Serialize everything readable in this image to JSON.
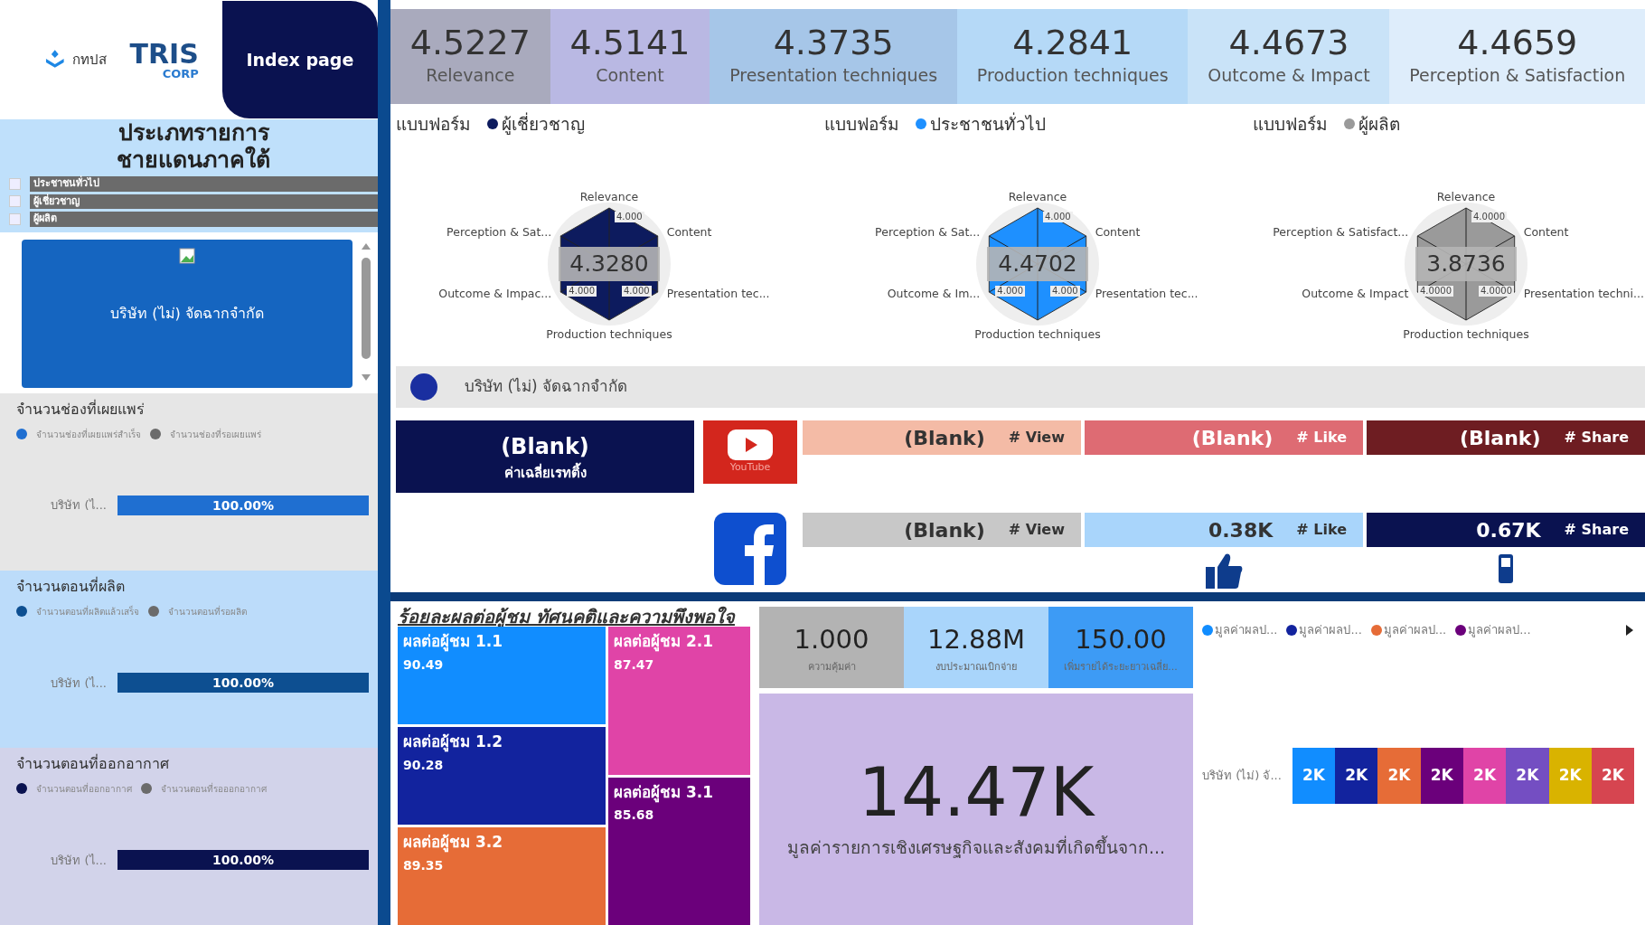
{
  "sidebar": {
    "agency_logo": "กทปส",
    "tris_logo": "TRIS",
    "tris_sub": "CORP",
    "index_button": "Index page",
    "filter": {
      "title": "ประเภทรายการชายแดนภาคใต้",
      "options": [
        {
          "label": "ประชาชนทั่วไป",
          "checked": false
        },
        {
          "label": "ผู้เชี่ยวชาญ",
          "checked": false
        },
        {
          "label": "ผู้ผลิต",
          "checked": false
        }
      ]
    },
    "company_list": {
      "items": [
        {
          "label": "บริษัท (ไม่) จัดฉากจำกัด",
          "selected": true
        }
      ]
    },
    "sections": [
      {
        "title": "จำนวนช่องที่เผยแพร่",
        "legend": [
          {
            "label": "จำนวนช่องที่เผยแพร่สำเร็จ",
            "color": "#1f6fd1"
          },
          {
            "label": "จำนวนช่องที่รอเผยแพร่",
            "color": "#6b6b6b"
          }
        ],
        "bar": {
          "label": "บริษัท (ไ...",
          "level": 1,
          "reading": "100.00%"
        }
      },
      {
        "title": "จำนวนตอนที่ผลิต",
        "legend": [
          {
            "label": "จำนวนตอนที่ผลิตแล้วเสร็จ",
            "color": "#0d4f91"
          },
          {
            "label": "จำนวนตอนที่รอผลิต",
            "color": "#6b6b6b"
          }
        ],
        "bar": {
          "label": "บริษัท (ไ...",
          "level": 1,
          "reading": "100.00%"
        }
      },
      {
        "title": "จำนวนตอนที่ออกอากาศ",
        "legend": [
          {
            "label": "จำนวนตอนที่ออกอากาศ",
            "color": "#0a1250"
          },
          {
            "label": "จำนวนตอนที่รอออกอากาศ",
            "color": "#6b6b6b"
          }
        ],
        "bar": {
          "label": "บริษัท (ไ...",
          "level": 1,
          "reading": "100.00%"
        }
      }
    ]
  },
  "kpis": [
    {
      "value": "4.5227",
      "label": "Relevance",
      "color": "#a9aabd"
    },
    {
      "value": "4.5141",
      "label": "Content",
      "color": "#b9b8e3"
    },
    {
      "value": "4.3735",
      "label": "Presentation techniques",
      "color": "#a6c6e8"
    },
    {
      "value": "4.2841",
      "label": "Production techniques",
      "color": "#b5d9f7"
    },
    {
      "value": "4.4673",
      "label": "Outcome & Impact",
      "color": "#c9e3f8"
    },
    {
      "value": "4.4659",
      "label": "Perception & Satisfaction",
      "color": "#deedfb"
    }
  ],
  "radars": [
    {
      "form_label": "แบบฟอร์ม",
      "series_name": "ผู้เชี่ยวชาญ",
      "color": "#0d1b5e",
      "value": "4.3280",
      "tick_labels": [
        "4.000",
        "4.000",
        "4.000"
      ],
      "axes": [
        "Relevance",
        "Perception & Sat...",
        "Content",
        "Outcome & Impac...",
        "Presentation tec...",
        "Production techniques"
      ]
    },
    {
      "form_label": "แบบฟอร์ม",
      "series_name": "ประชาชนทั่วไป",
      "color": "#1e90ff",
      "value": "4.4702",
      "tick_labels": [
        "4.000",
        "4.000",
        "4.000"
      ],
      "axes": [
        "Relevance",
        "Perception & Sat...",
        "Content",
        "Outcome & Im...",
        "Presentation tec...",
        "Production techniques"
      ]
    },
    {
      "form_label": "แบบฟอร์ม",
      "series_name": "ผู้ผลิต",
      "color": "#9a9a9a",
      "value": "3.8736",
      "tick_labels": [
        "4.0000",
        "4.0000",
        "4.0000"
      ],
      "axes": [
        "Relevance",
        "Perception & Satisfact...",
        "Content",
        "Outcome & Impact",
        "Presentation techni...",
        "Production techniques"
      ]
    }
  ],
  "company_legend": {
    "label": "บริษัท (ไม่) จัดฉากจำกัด",
    "color": "#1a2fa0"
  },
  "rating": {
    "value": "(Blank)",
    "label": "ค่าเฉลี่ยเรทติ้ง"
  },
  "social": [
    {
      "kind": "youtube",
      "platform_label": "YouTube",
      "metrics": [
        {
          "value": "(Blank)",
          "label": "# View",
          "color": "#f4bba6"
        },
        {
          "value": "(Blank)",
          "label": "# Like",
          "color": "#de6b73"
        },
        {
          "value": "(Blank)",
          "label": "# Share",
          "color": "#6e1d22"
        }
      ]
    },
    {
      "kind": "facebook",
      "metrics": [
        {
          "value": "(Blank)",
          "label": "# View",
          "color": "#c8c8c8"
        },
        {
          "value": "0.38K",
          "label": "# Like",
          "color": "#a9d5fb"
        },
        {
          "value": "0.67K",
          "label": "# Share",
          "color": "#0a1250"
        }
      ]
    }
  ],
  "impact": {
    "title": "ร้อยละผลต่อผู้ชม ทัศนคติและความพึงพอใจ",
    "tiles": [
      {
        "label": "ผลต่อผู้ชม 1.1",
        "value": "90.49",
        "color": "#118dff"
      },
      {
        "label": "ผลต่อผู้ชม 1.2",
        "value": "90.28",
        "color": "#12239e"
      },
      {
        "label": "ผลต่อผู้ชม 3.2",
        "value": "89.35",
        "color": "#e66c37"
      },
      {
        "label": "ผลต่อผู้ชม 2.1",
        "value": "87.47",
        "color": "#e044a7"
      },
      {
        "label": "ผลต่อผู้ชม 3.1",
        "value": "85.68",
        "color": "#6b007b"
      }
    ]
  },
  "value_kpis": [
    {
      "value": "1.000",
      "label": "ความคุ้มค่า",
      "color": "#b3b3b3"
    },
    {
      "value": "12.88M",
      "label": "งบประมาณเบิกจ่าย",
      "color": "#a9d5fb"
    },
    {
      "value": "150.00",
      "label": "เพิ่มรายได้ระยะยาวเฉลี่ย...",
      "color": "#3d9bf5"
    }
  ],
  "big_value": {
    "value": "14.47K",
    "label": "มูลค่ารายการเชิงเศรษฐกิจและสังคมที่เกิดขึ้นจาก..."
  },
  "value_breakdown": {
    "legend": [
      {
        "label": "มูลค่าผลป...",
        "color": "#118dff"
      },
      {
        "label": "มูลค่าผลป...",
        "color": "#12239e"
      },
      {
        "label": "มูลค่าผลป...",
        "color": "#e66c37"
      },
      {
        "label": "มูลค่าผลป...",
        "color": "#6b007b"
      }
    ],
    "row_label": "บริษัท (ไม่) จั...",
    "segments": [
      {
        "label": "2K",
        "color": "#118dff"
      },
      {
        "label": "2K",
        "color": "#12239e"
      },
      {
        "label": "2K",
        "color": "#e66c37"
      },
      {
        "label": "2K",
        "color": "#6b007b"
      },
      {
        "label": "2K",
        "color": "#e044a7"
      },
      {
        "label": "2K",
        "color": "#744ec2"
      },
      {
        "label": "2K",
        "color": "#d9b300"
      },
      {
        "label": "2K",
        "color": "#d64550"
      }
    ]
  }
}
